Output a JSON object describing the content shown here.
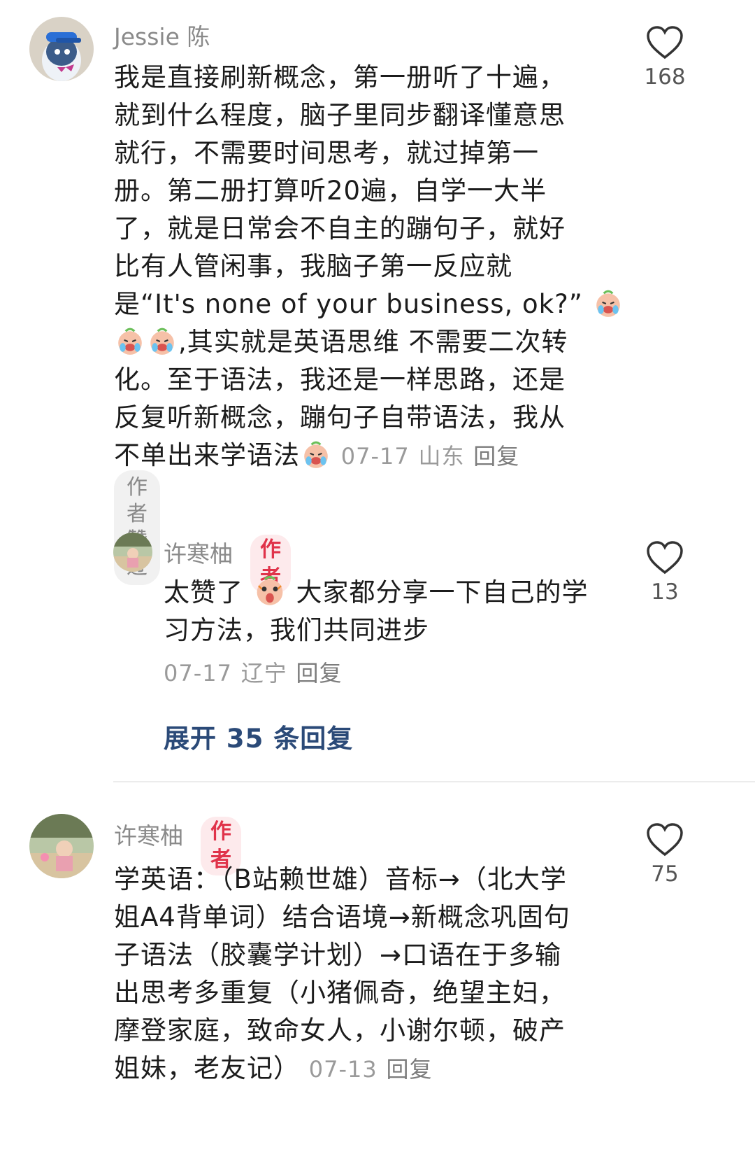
{
  "comments": [
    {
      "username": "Jessie 陈",
      "likes": "168",
      "body_lines": [
        "我是直接刷新概念，第一册听了十遍，",
        "就到什么程度，脑子里同步翻译懂意思",
        "就行，不需要时间思考，就过掉第一",
        "册。第二册打算听20遍，自学一大半",
        "了，就是日常会不自主的蹦句子，就好",
        "比有人管闲事，我脑子第一反应就"
      ],
      "line7_text": "是“It's none of your business, ok?”",
      "line8_text": ",其实就是英语思维 不需要二次转",
      "line9_text": "化。至于语法，我还是一样思路，还是",
      "line10_text": "反复听新概念，蹦句子自带语法，我从",
      "line11_text": "不单出来学语法",
      "date": "07-17",
      "location": "山东",
      "reply": "回复",
      "liked_by_author": "作者赞过"
    },
    {
      "username": "许寒柚",
      "author_tag": "作者",
      "likes": "13",
      "line1_a": "太赞了",
      "line1_b": "大家都分享一下自己的学",
      "line2": "习方法，我们共同进步",
      "date": "07-17",
      "location": "辽宁",
      "reply": "回复"
    },
    {
      "username": "许寒柚",
      "author_tag": "作者",
      "likes": "75",
      "body_lines": [
        "学英语：（B站赖世雄）音标→（北大学",
        "姐A4背单词）结合语境→新概念巩固句",
        "子语法（胶囊学计划）→口语在于多输",
        "出思考多重复（小猪佩奇，绝望主妇，",
        "摩登家庭，致命女人，小谢尔顿，破产"
      ],
      "last_line": "姐妹，老友记）",
      "date": "07-13",
      "reply": "回复"
    }
  ],
  "expand_replies": "展开 35 条回复",
  "icons": {
    "like": "heart-outline-icon",
    "emoji": "crying-laughing-emoji-icon",
    "emoji2": "shocked-emoji-icon"
  },
  "colors": {
    "author_tag": "#e0334a",
    "expand": "#2b4a78"
  }
}
